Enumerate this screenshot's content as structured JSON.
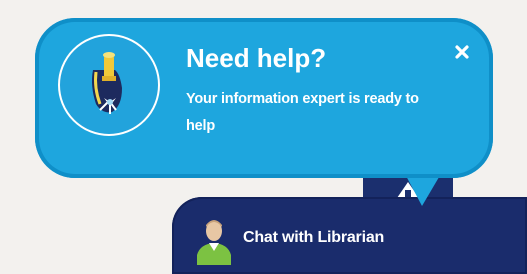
{
  "help_popup": {
    "title": "Need help?",
    "message": "Your information expert is ready to help",
    "close_icon": "close-icon",
    "librarian_icon": "librarian-icon"
  },
  "chat_bar": {
    "label": "Chat with Librarian",
    "avatar_icon": "user-avatar-icon"
  },
  "colors": {
    "bubble": "#1ea6de",
    "bar": "#1a2c6c",
    "text": "#ffffff"
  }
}
